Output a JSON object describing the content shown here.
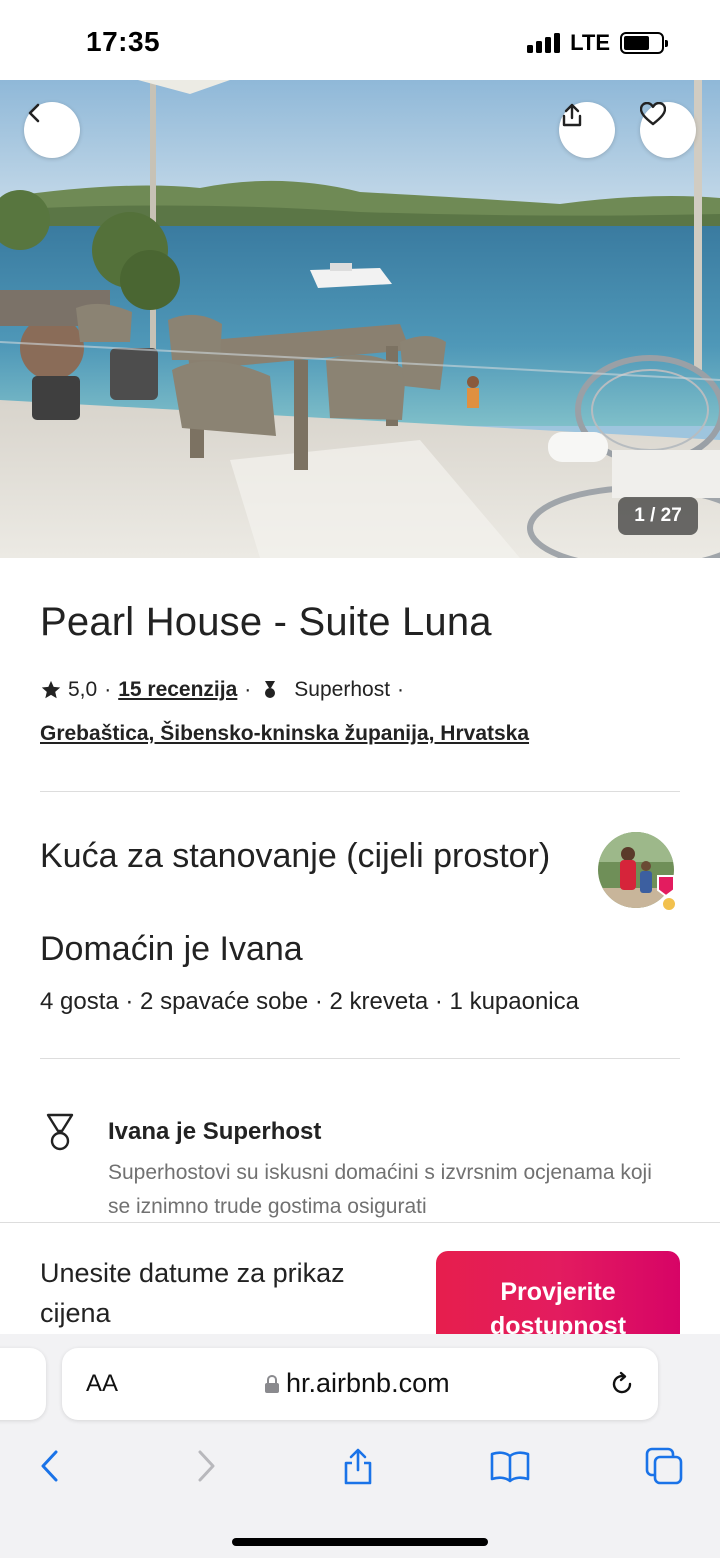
{
  "status_bar": {
    "time": "17:35",
    "network": "LTE",
    "battery_level": 0.7
  },
  "hero": {
    "photo_counter": "1 / 27",
    "icons": [
      "back-chevron-icon",
      "share-icon",
      "heart-icon"
    ]
  },
  "listing": {
    "title": "Pearl House - Suite Luna",
    "rating": "5,0",
    "reviews_link": "15 recenzija",
    "separator": "·",
    "superhost_label": "Superhost",
    "location": "Grebaštica, Šibensko-kninska županija, Hrvatska"
  },
  "overview": {
    "property_type": "Kuća za stanovanje (cijeli prostor)",
    "host_line": "Domaćin je Ivana",
    "guest_info": "4 gosta · 2 spavaće sobe · 2 kreveta · 1 kupaonica"
  },
  "highlight": {
    "title": "Ivana je Superhost",
    "description": "Superhostovi su iskusni domaćini s izvrsnim ocjenama koji se iznimno trude gostima osigurati"
  },
  "booking": {
    "prompt": "Unesite datume za prikaz cijena",
    "button_label": "Provjerite dostupnost"
  },
  "browser": {
    "text_size_button": "AA",
    "url": "hr.airbnb.com"
  },
  "colors": {
    "accent": "#E31C5F",
    "text_primary": "#222222",
    "text_secondary": "#717171",
    "browser_icon": "#1a73e8",
    "divider": "#DDDDDD"
  }
}
